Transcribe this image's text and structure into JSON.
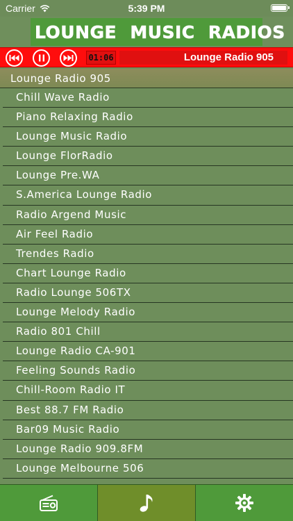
{
  "status_bar": {
    "carrier": "Carrier",
    "time": "5:39 PM"
  },
  "header": {
    "title": "LOUNGE MUSIC RADIOS"
  },
  "player": {
    "elapsed": "01:06",
    "now_playing": "Lounge Radio 905"
  },
  "list": {
    "header": "Lounge Radio 905",
    "items": [
      "Chill Wave Radio",
      "Piano Relaxing Radio",
      "Lounge Music Radio",
      "Lounge FlorRadio",
      "Lounge Pre.WA",
      "S.America Lounge Radio",
      "Radio Argend Music",
      "Air Feel Radio",
      "Trendes Radio",
      "Chart Lounge Radio",
      "Radio Lounge 506TX",
      "Lounge Melody Radio",
      "Radio 801 Chill",
      "Lounge Radio CA-901",
      "Feeling Sounds Radio",
      "Chill-Room Radio IT",
      "Best 88.7 FM Radio",
      "Bar09 Music Radio",
      "Lounge Radio 909.8FM",
      "Lounge Melbourne 506"
    ]
  },
  "tabs": [
    {
      "icon": "radio-icon",
      "active": false
    },
    {
      "icon": "music-note-icon",
      "active": true
    },
    {
      "icon": "gear-icon",
      "active": false
    }
  ],
  "colors": {
    "background": "#6f8f5c",
    "accent_green": "#4f9a3a",
    "player_red": "#ff0d0d",
    "text": "#ffffff"
  }
}
